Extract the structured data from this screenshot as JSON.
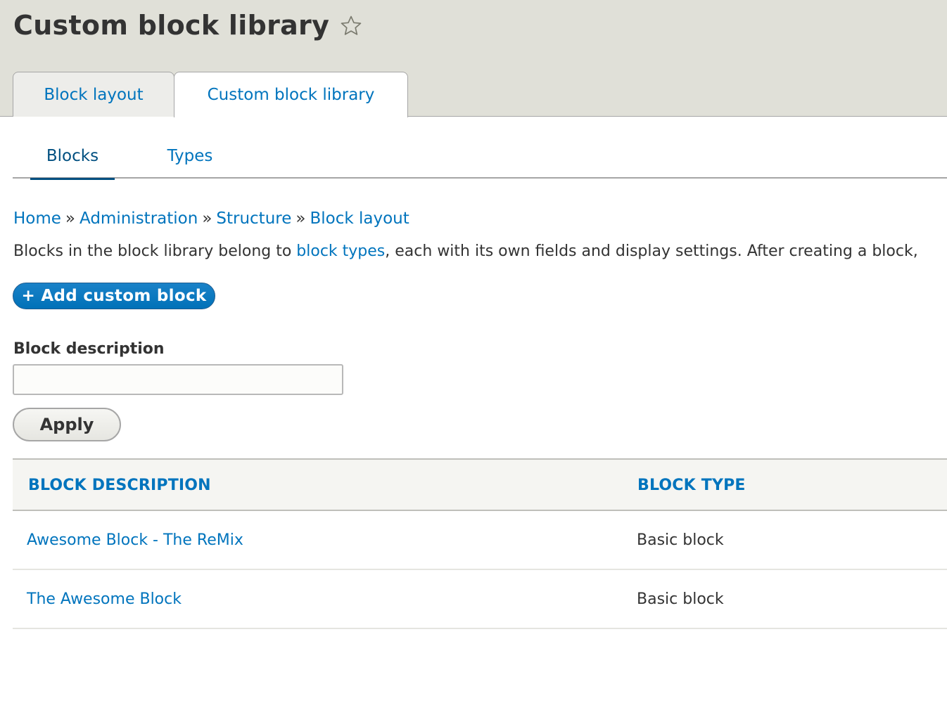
{
  "header": {
    "title": "Custom block library",
    "star_icon": "star-outline-icon",
    "tabs": [
      {
        "label": "Block layout",
        "active": false
      },
      {
        "label": "Custom block library",
        "active": true
      }
    ]
  },
  "subtabs": [
    {
      "label": "Blocks",
      "active": true
    },
    {
      "label": "Types",
      "active": false
    }
  ],
  "breadcrumb": {
    "items": [
      "Home",
      "Administration",
      "Structure",
      "Block layout"
    ],
    "separator": "»"
  },
  "description": {
    "before": "Blocks in the block library belong to ",
    "link": "block types",
    "after": ", each with its own fields and display settings. After creating a block,"
  },
  "add_button": {
    "label": "+ Add custom block"
  },
  "filter": {
    "label": "Block description",
    "value": "",
    "placeholder": "",
    "apply_label": "Apply"
  },
  "table": {
    "columns": [
      "BLOCK DESCRIPTION",
      "BLOCK TYPE"
    ],
    "rows": [
      {
        "description": "Awesome Block - The ReMix",
        "type": "Basic block"
      },
      {
        "description": "The Awesome Block",
        "type": "Basic block"
      }
    ]
  },
  "colors": {
    "link": "#0074bd",
    "header_bg": "#e0e0d8",
    "primary_button": "#0071b8",
    "text": "#333333"
  }
}
